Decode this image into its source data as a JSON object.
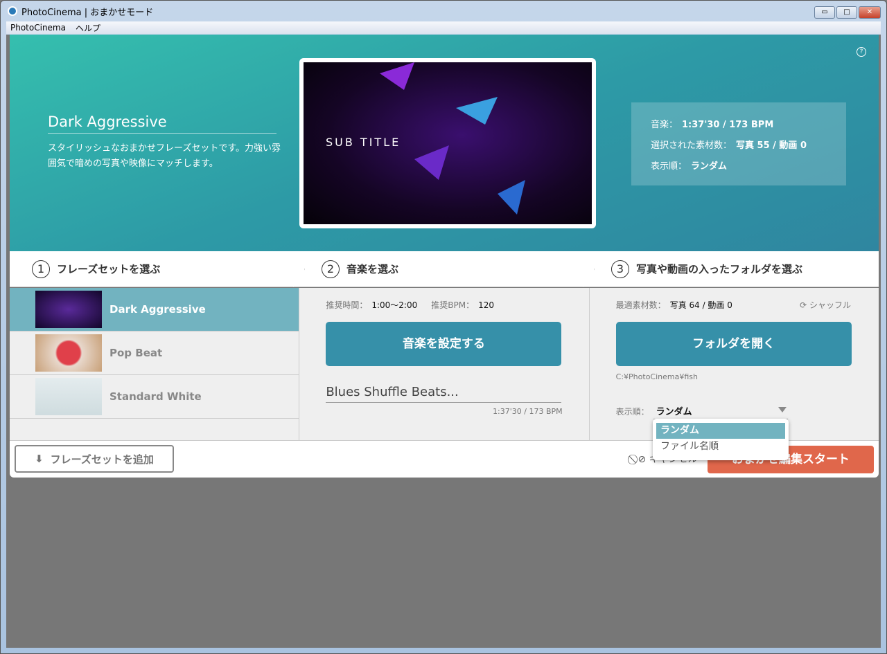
{
  "window": {
    "title": "PhotoCinema | おまかせモード",
    "minimize": "▭",
    "maximize": "□",
    "close": "✕"
  },
  "menu": [
    "PhotoCinema",
    "ヘルプ"
  ],
  "hero": {
    "title": "Dark Aggressive",
    "description": "スタイリッシュなおまかせフレーズセットです。力強い雰囲気で暗めの写真や映像にマッチします。",
    "preview_text": "SUB TITLE",
    "help": "?",
    "info": [
      {
        "label": "音楽：",
        "value": "1:37'30 / 173 BPM"
      },
      {
        "label": "選択された素材数：",
        "value": "写真 55 / 動画 0"
      },
      {
        "label": "表示順：",
        "value": "ランダム"
      }
    ]
  },
  "steps": [
    {
      "num": "1",
      "label": "フレーズセットを選ぶ"
    },
    {
      "num": "2",
      "label": "音楽を選ぶ"
    },
    {
      "num": "3",
      "label": "写真や動画の入ったフォルダを選ぶ"
    }
  ],
  "phrasesets": [
    {
      "name": "Dark Aggressive",
      "color": "#2a0f55"
    },
    {
      "name": "Pop Beat",
      "color": "#d9b99a"
    },
    {
      "name": "Standard White",
      "color": "#dfe8ea"
    }
  ],
  "music": {
    "rec_time_label": "推奨時間：",
    "rec_time": "1:00〜2:00",
    "rec_bpm_label": "推奨BPM：",
    "rec_bpm": "120",
    "button": "音楽を設定する",
    "song": "Blues Shuffle Beats...",
    "song_meta": "1:37'30 / 173 BPM"
  },
  "folder": {
    "count_label": "最適素材数：",
    "count": "写真 64 / 動画 0",
    "shuffle": "シャッフル",
    "button": "フォルダを開く",
    "path": "C:¥PhotoCinema¥fish",
    "order_label": "表示順：",
    "order_value": "ランダム",
    "options": [
      "ランダム",
      "ファイル名順"
    ]
  },
  "footer": {
    "add": "フレーズセットを追加",
    "cancel": "キャンセル",
    "start": "おまかせ編集スタート"
  }
}
